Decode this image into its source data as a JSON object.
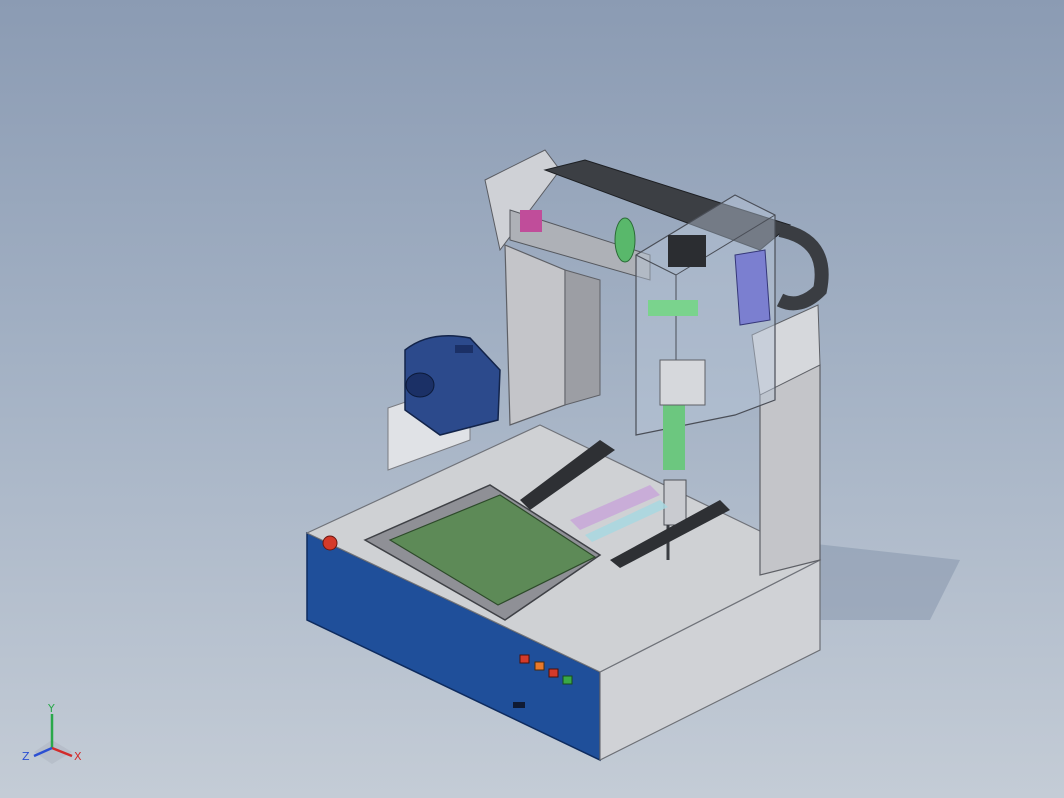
{
  "viewport": {
    "background_top": "#8b9bb3",
    "background_bottom": "#c4ccd6"
  },
  "model": {
    "type": "3d-cad-assembly",
    "colors": {
      "base_blue": "#1f4f9a",
      "frame_gray": "#c9c9cc",
      "pcb_green": "#5d8a57",
      "accent_green": "#59b86b",
      "motor_blue": "#2c4a8c",
      "button_red": "#d43a2a",
      "button_orange": "#e8792a",
      "button_green": "#3aa845"
    }
  },
  "triad": {
    "x_label": "X",
    "y_label": "Y",
    "z_label": "Z",
    "x_color": "#d22b2b",
    "y_color": "#2aa84a",
    "z_color": "#2b4fd2"
  }
}
